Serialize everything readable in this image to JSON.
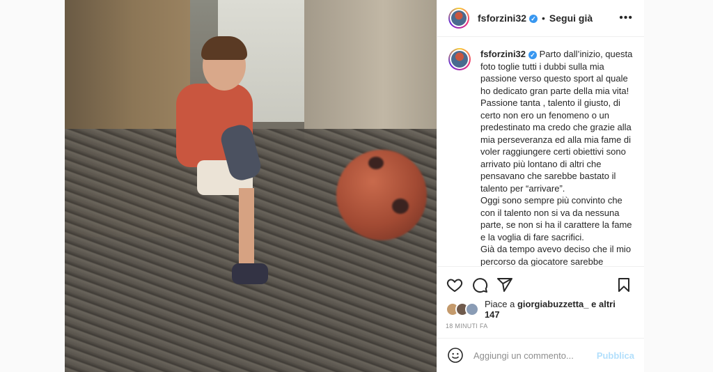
{
  "post": {
    "username": "fsforzini32",
    "follow_label": "Segui già",
    "caption": "Parto dall’inizio, questa foto toglie tutti i dubbi sulla mia passione verso questo sport al quale ho dedicato gran parte della mia vita! Passione tanta , talento il giusto, di certo non ero un fenomeno o un predestinato ma credo che grazie alla mia perseveranza ed alla mia fame di voler raggiungere certi obiettivi sono arrivato più lontano di altri che pensavano che sarebbe bastato il talento per “arrivare”.\nOggi sono sempre più convinto che con il talento non si va da nessuna parte, se non si ha il carattere la fame e la voglia di fare sacrifici.\nGià da tempo avevo deciso che il mio percorso da giocatore sarebbe terminato, ma ammetto che prima di",
    "likes_prefix": "Piace a",
    "likes_user": "giorgiabuzzetta_",
    "likes_suffix": "e altri 147",
    "timestamp": "18 MINUTI FA",
    "comment_placeholder": "Aggiungi un commento...",
    "publish_label": "Pubblica"
  },
  "icons": [
    "more-icon",
    "heart-icon",
    "comment-icon",
    "share-icon",
    "save-icon",
    "emoji-icon",
    "verified-icon"
  ],
  "colors": {
    "accent": "#3897f0",
    "publish_disabled": "#b2dffc"
  }
}
